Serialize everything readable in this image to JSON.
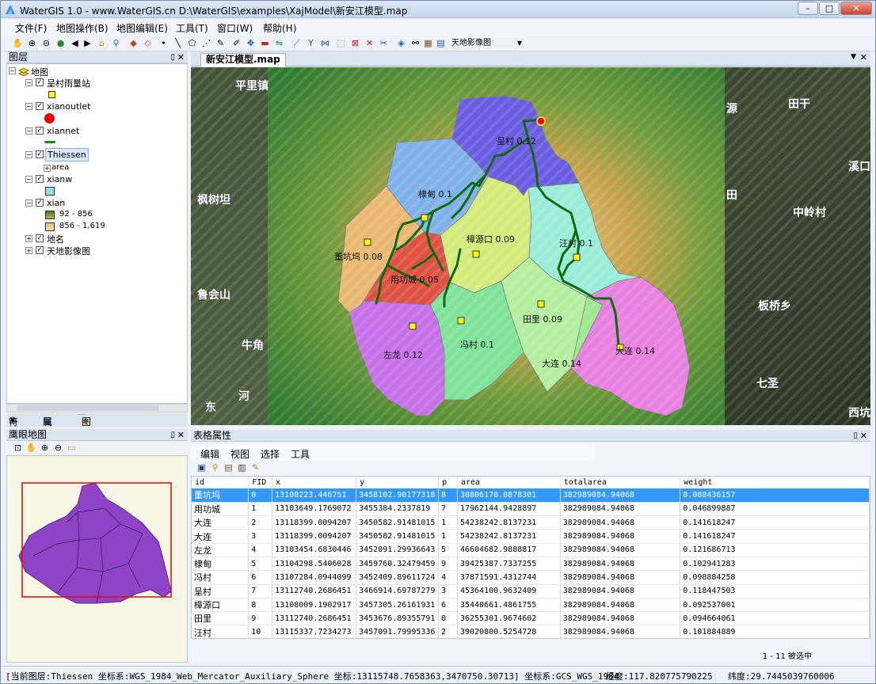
{
  "window": {
    "title": "WaterGIS 1.0 - www.WaterGIS.cn D:\\WaterGIS\\examples\\XajModel\\新安江模型.map"
  },
  "menu": [
    "文件(F)",
    "地图操作(B)",
    "地图编辑(E)",
    "工具(T)",
    "窗口(W)",
    "帮助(H)"
  ],
  "toolbar": {
    "basemap_select": "天地影像图"
  },
  "layers_panel": {
    "title": "图层",
    "root": "地图",
    "items": [
      {
        "name": "呈村雨量站",
        "legend": "yellow-square"
      },
      {
        "name": "xianoutlet",
        "legend": "red-circle"
      },
      {
        "name": "xiannet",
        "legend": "green-line"
      },
      {
        "name": "Thiessen",
        "sub": "area"
      },
      {
        "name": "xianw",
        "legend": "cyan-square"
      },
      {
        "name": "xian",
        "ranges": [
          "92 - 856",
          "856 - 1,619"
        ]
      },
      {
        "name": "地名"
      },
      {
        "name": "天地影像图"
      }
    ],
    "tabs": [
      "符号",
      "属性",
      "图层"
    ]
  },
  "overview_panel": {
    "title": "鹰眼地图"
  },
  "map": {
    "tab": "新安江模型.map",
    "stations": [
      {
        "label": "呈村 0.12"
      },
      {
        "label": "棣甸 0.1"
      },
      {
        "label": "樟源口 0.09"
      },
      {
        "label": "汪村 0.1"
      },
      {
        "label": "董坑坞 0.08"
      },
      {
        "label": "用功城 0.05"
      },
      {
        "label": "田里 0.09"
      },
      {
        "label": "左龙 0.12"
      },
      {
        "label": "冯村 0.1"
      },
      {
        "label": "大连 0.14"
      },
      {
        "label": "大连 0.14"
      }
    ],
    "places": [
      "平里镇",
      "枫树坦",
      "鲁会山",
      "牛角",
      "东",
      "河",
      "源",
      "田干",
      "溪口",
      "中岭村",
      "板桥乡",
      "七圣",
      "西坑",
      "田"
    ]
  },
  "table_panel": {
    "title": "表格属性",
    "menu": [
      "编辑",
      "视图",
      "选择",
      "工具"
    ],
    "columns": [
      "id",
      "FID",
      "x",
      "y",
      "p",
      "area",
      "totalarea",
      "weight"
    ],
    "rows": [
      [
        "董坑坞",
        "0",
        "13100223.446751",
        "3458102.90177318",
        "8",
        "30806170.0878301",
        "382989084.94068",
        "0.080436157"
      ],
      [
        "用功城",
        "1",
        "13103649.1769072",
        "3455384.2337819",
        "7",
        "17962144.9428897",
        "382989084.94068",
        "0.046899887"
      ],
      [
        "大连",
        "2",
        "13118399.0094207",
        "3450582.91481015",
        "1",
        "54238242.8137231",
        "382989084.94068",
        "0.141618247"
      ],
      [
        "大连",
        "3",
        "13118399.0094207",
        "3450582.91481015",
        "1",
        "54238242.8137231",
        "382989084.94068",
        "0.141618247"
      ],
      [
        "左龙",
        "4",
        "13103454.6830446",
        "3452091.29936643",
        "5",
        "46604682.9888817",
        "382989084.94068",
        "0.121686713"
      ],
      [
        "棣甸",
        "5",
        "13104298.5406028",
        "3459760.32479459",
        "9",
        "39425387.7337255",
        "382989084.94068",
        "0.102941283"
      ],
      [
        "冯村",
        "6",
        "13107284.0944099",
        "3452409.89611724",
        "4",
        "37871591.4312744",
        "382989084.94068",
        "0.098884258"
      ],
      [
        "呈村",
        "7",
        "13112740.2686451",
        "3466914.69787279",
        "3",
        "45364100.9632409",
        "382989084.94068",
        "0.118447503"
      ],
      [
        "樟源口",
        "8",
        "13108009.1902917",
        "3457305.26161931",
        "6",
        "35440661.4861755",
        "382989084.94068",
        "0.092537001"
      ],
      [
        "田里",
        "9",
        "13112740.2686451",
        "3453676.89355791",
        "0",
        "36255301.9674602",
        "382989084.94068",
        "0.094664061"
      ],
      [
        "汪村",
        "10",
        "13115337.7234273",
        "3457091.79995336",
        "2",
        "39020800.5254728",
        "382989084.94068",
        "0.101884889"
      ]
    ],
    "selection_status": "1 - 11 被选中"
  },
  "statusbar": {
    "current_layer": "[当前图层:Thiessen 坐标系:WGS_1984_Web_Mercator_Auxiliary_Sphere 坐标:13115748.7658363,3470750.30713] 坐标系:GCS_WGS_1984",
    "longitude": "经度:117.820775790225",
    "latitude": "纬度:29.7445039760006"
  }
}
